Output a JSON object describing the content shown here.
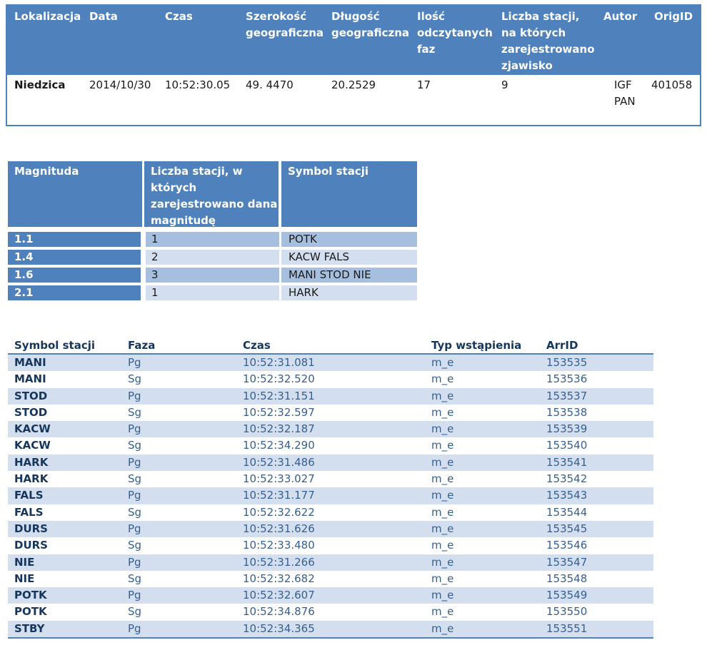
{
  "event": {
    "headers": [
      "Lokalizacja",
      "Data",
      "Czas",
      "Szerokość geograficzna",
      "Długość geograficzna",
      "Ilość odczytanych faz",
      "Liczba stacji, na których zarejestrowano zjawisko",
      "Autor",
      "OrigID"
    ],
    "values": [
      "Niedzica",
      "2014/10/30",
      "10:52:30.05",
      "49. 4470",
      "20.2529",
      "17",
      "9",
      "IGF PAN",
      "401058"
    ]
  },
  "magnitudes": {
    "headers": [
      "Magnituda",
      "Liczba stacji, w których zarejestrowano dana magnitudę",
      "Symbol stacji"
    ],
    "rows": [
      {
        "mag": "1.1",
        "count": "1",
        "stations": "POTK"
      },
      {
        "mag": "1.4",
        "count": "2",
        "stations": "KACW FALS"
      },
      {
        "mag": "1.6",
        "count": "3",
        "stations": "MANI STOD NIE"
      },
      {
        "mag": "2.1",
        "count": "1",
        "stations": "HARK"
      }
    ]
  },
  "arrivals": {
    "headers": [
      "Symbol stacji",
      "Faza",
      "Czas",
      "Typ wstąpienia",
      "ArrID"
    ],
    "rows": [
      [
        "MANI",
        "Pg",
        "10:52:31.081",
        "m_e",
        "153535"
      ],
      [
        "MANI",
        "Sg",
        "10:52:32.520",
        "m_e",
        "153536"
      ],
      [
        "STOD",
        "Pg",
        "10:52:31.151",
        "m_e",
        "153537"
      ],
      [
        "STOD",
        "Sg",
        "10:52:32.597",
        "m_e",
        "153538"
      ],
      [
        "KACW",
        "Pg",
        "10:52:32.187",
        "m_e",
        "153539"
      ],
      [
        "KACW",
        "Sg",
        "10:52:34.290",
        "m_e",
        "153540"
      ],
      [
        "HARK",
        "Pg",
        "10:52:31.486",
        "m_e",
        "153541"
      ],
      [
        "HARK",
        "Sg",
        "10:52:33.027",
        "m_e",
        "153542"
      ],
      [
        "FALS",
        "Pg",
        "10:52:31.177",
        "m_e",
        "153543"
      ],
      [
        "FALS",
        "Sg",
        "10:52:32.622",
        "m_e",
        "153544"
      ],
      [
        "DURS",
        "Pg",
        "10:52:31.626",
        "m_e",
        "153545"
      ],
      [
        "DURS",
        "Sg",
        "10:52:33.480",
        "m_e",
        "153546"
      ],
      [
        "NIE",
        "Pg",
        "10:52:31.266",
        "m_e",
        "153547"
      ],
      [
        "NIE",
        "Sg",
        "10:52:32.682",
        "m_e",
        "153548"
      ],
      [
        "POTK",
        "Pg",
        "10:52:32.607",
        "m_e",
        "153549"
      ],
      [
        "POTK",
        "Sg",
        "10:52:34.876",
        "m_e",
        "153550"
      ],
      [
        "STBY",
        "Pg",
        "10:52:34.365",
        "m_e",
        "153551"
      ]
    ]
  }
}
